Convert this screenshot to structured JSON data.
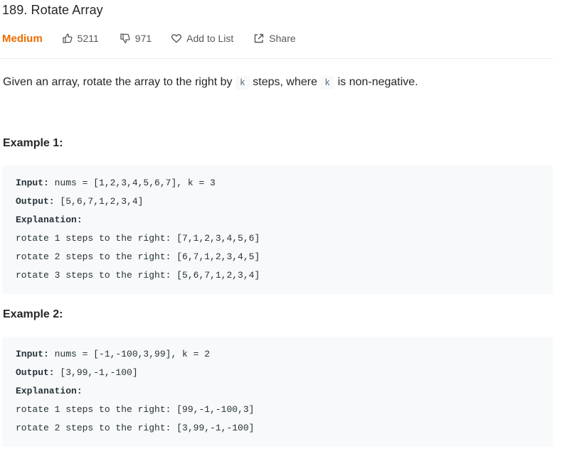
{
  "problem": {
    "title": "189. Rotate Array",
    "difficulty": "Medium",
    "likes": "5211",
    "dislikes": "971",
    "add_to_list": "Add to List",
    "share": "Share",
    "accent_color": "#ef6c00"
  },
  "description": {
    "part1": "Given an array, rotate the array to the right by",
    "code1": "k",
    "part2": "steps, where",
    "code2": "k",
    "part3": "is non-negative."
  },
  "examples": [
    {
      "title": "Example 1:",
      "input_label": "Input:",
      "input_value": " nums = [1,2,3,4,5,6,7], k = 3",
      "output_label": "Output:",
      "output_value": " [5,6,7,1,2,3,4]",
      "explanation_label": "Explanation:",
      "steps": [
        "rotate 1 steps to the right: [7,1,2,3,4,5,6]",
        "rotate 2 steps to the right: [6,7,1,2,3,4,5]",
        "rotate 3 steps to the right: [5,6,7,1,2,3,4]"
      ]
    },
    {
      "title": "Example 2:",
      "input_label": "Input:",
      "input_value": " nums = [-1,-100,3,99], k = 2",
      "output_label": "Output:",
      "output_value": " [3,99,-1,-100]",
      "explanation_label": "Explanation:",
      "steps": [
        "rotate 1 steps to the right: [99,-1,-100,3]",
        "rotate 2 steps to the right: [3,99,-1,-100]"
      ]
    }
  ],
  "icons": {
    "like": "thumbs-up-icon",
    "dislike": "thumbs-down-icon",
    "add_to_list": "heart-icon",
    "share": "share-icon"
  }
}
